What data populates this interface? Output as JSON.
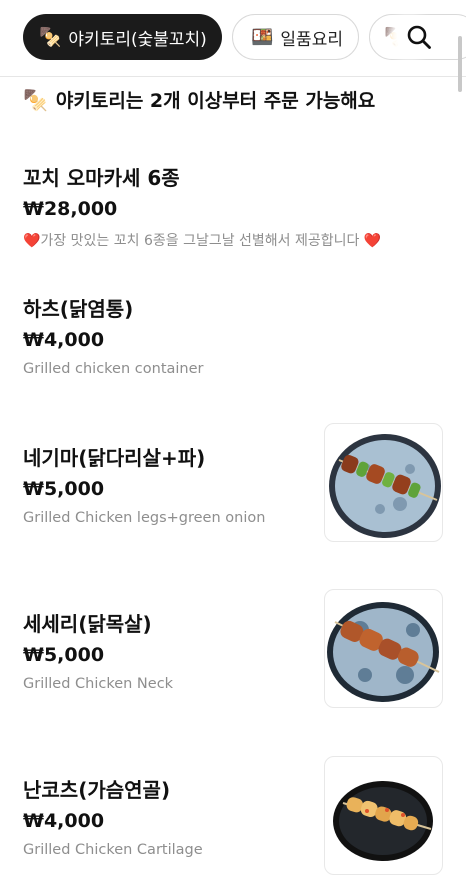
{
  "tabs": [
    {
      "icon": "skewer-icon",
      "emoji": "🍢",
      "label": "야키토리(숯불꼬치)",
      "active": true
    },
    {
      "icon": "bento-icon",
      "emoji": "🍱",
      "label": "일품요리",
      "active": false
    },
    {
      "icon": "skewer-icon",
      "emoji": "🍢",
      "label": "",
      "active": false
    }
  ],
  "search": {
    "icon": "search-icon"
  },
  "notice": {
    "emoji": "🍢",
    "text": "야키토리는 2개 이상부터 주문 가능해요"
  },
  "items": [
    {
      "name": "꼬치 오마카세 6종",
      "price": "₩28,000",
      "desc_heart_left": "❤️",
      "description": "가장 맛있는 꼬치 6종을 그날그날 선별해서 제공합니다",
      "desc_heart_right": "❤️",
      "has_image": false
    },
    {
      "name": "하츠(닭염통)",
      "price": "₩4,000",
      "description": "Grilled chicken container",
      "has_image": false
    },
    {
      "name": "네기마(닭다리살+파)",
      "price": "₩5,000",
      "description": "Grilled Chicken legs+green onion",
      "has_image": true
    },
    {
      "name": "세세리(닭목살)",
      "price": "₩5,000",
      "description": "Grilled Chicken Neck",
      "has_image": true
    },
    {
      "name": "난코츠(가슴연골)",
      "price": "₩4,000",
      "description": "Grilled Chicken Cartilage",
      "has_image": true
    }
  ],
  "colors": {
    "active_tab_bg": "#1b1b1b",
    "desc_text": "#8e8e8e",
    "divider": "#e6e6e6",
    "heart": "#e0202b"
  }
}
